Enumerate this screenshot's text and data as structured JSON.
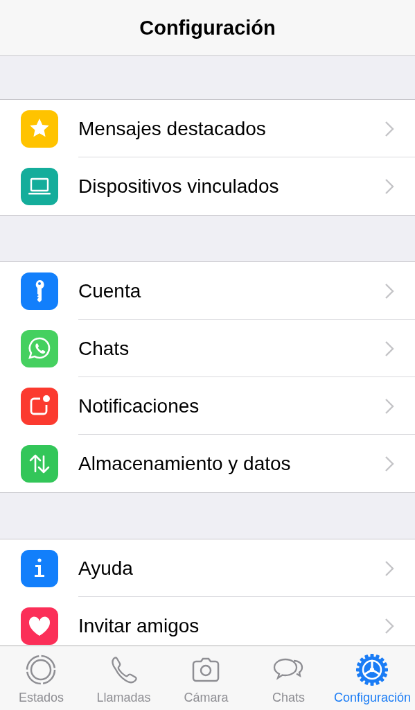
{
  "header": {
    "title": "Configuración"
  },
  "groups": [
    {
      "items": [
        {
          "label": "Mensajes destacados",
          "color": "#ffc300"
        },
        {
          "label": "Dispositivos vinculados",
          "color": "#14ad9b"
        }
      ]
    },
    {
      "items": [
        {
          "label": "Cuenta",
          "color": "#127ffb"
        },
        {
          "label": "Chats",
          "color": "#45d05f"
        },
        {
          "label": "Notificaciones",
          "color": "#fb3a2f"
        },
        {
          "label": "Almacenamiento y datos",
          "color": "#33c659"
        }
      ]
    },
    {
      "items": [
        {
          "label": "Ayuda",
          "color": "#127ffb"
        },
        {
          "label": "Invitar amigos",
          "color": "#fb2f58"
        }
      ]
    }
  ],
  "tab_bar": [
    {
      "label": "Estados",
      "selected": false
    },
    {
      "label": "Llamadas",
      "selected": false
    },
    {
      "label": "Cámara",
      "selected": false
    },
    {
      "label": "Chats",
      "selected": false
    },
    {
      "label": "Configuración",
      "selected": true
    }
  ]
}
